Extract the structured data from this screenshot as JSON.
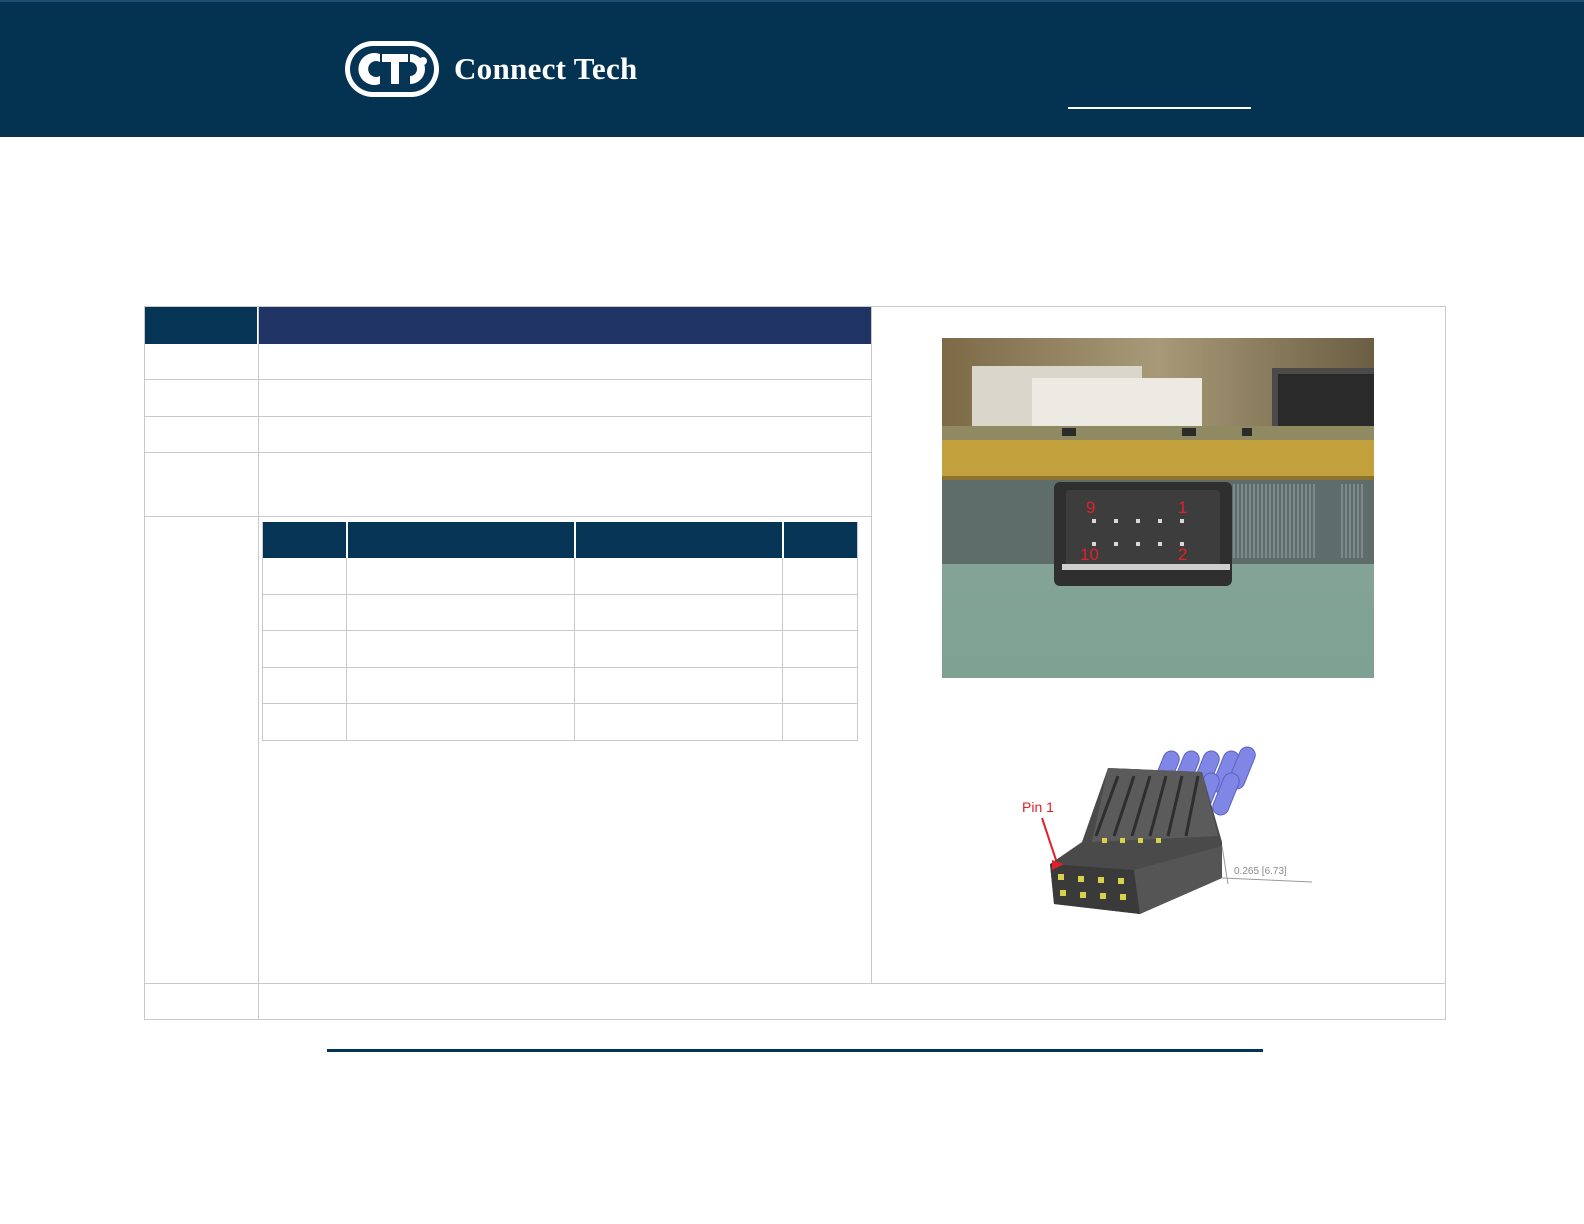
{
  "header": {
    "brand": "Connect Tech",
    "logo_icon": "cti-logo-icon"
  },
  "connector_photo": {
    "labels": [
      "9",
      "1",
      "10",
      "2"
    ],
    "label_color": "#e0212b"
  },
  "connector_drawing": {
    "pin_label": "Pin 1",
    "dimension": "0.265 [6.73]"
  },
  "colors": {
    "header_bg": "#033351",
    "table_header": "#1f3464",
    "table_header_dark": "#063454"
  }
}
